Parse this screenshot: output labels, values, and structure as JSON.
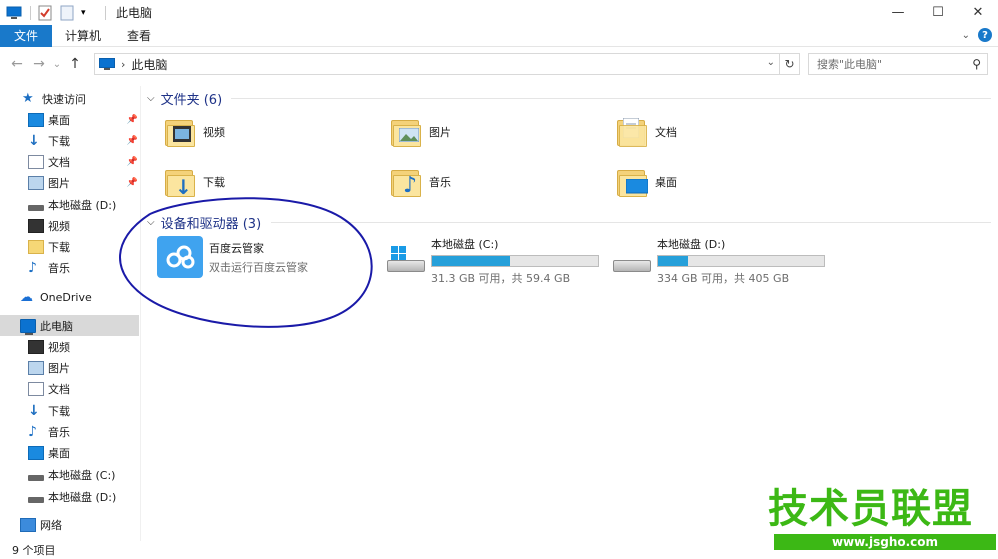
{
  "window": {
    "title": "此电脑",
    "minimize_glyph": "—",
    "maximize_glyph": "☐",
    "close_glyph": "✕"
  },
  "ribbon": {
    "tabs": [
      {
        "label": "文件"
      },
      {
        "label": "计算机"
      },
      {
        "label": "查看"
      }
    ],
    "expand_glyph": "⌄",
    "help_glyph": "?"
  },
  "address": {
    "back_glyph": "←",
    "forward_glyph": "→",
    "recent_glyph": "⌄",
    "up_glyph": "↑",
    "chevron_glyph": "›",
    "path": "此电脑",
    "dropdown_glyph": "⌄",
    "refresh_glyph": "↻"
  },
  "search": {
    "placeholder": "搜索\"此电脑\"",
    "icon_glyph": "⚲"
  },
  "sidebar": {
    "quick_access": {
      "label": "快速访问",
      "items": [
        {
          "label": "桌面",
          "pinned": true
        },
        {
          "label": "下载",
          "pinned": true
        },
        {
          "label": "文档",
          "pinned": true
        },
        {
          "label": "图片",
          "pinned": true
        },
        {
          "label": "本地磁盘 (D:)",
          "pinned": false
        },
        {
          "label": "视频",
          "pinned": false
        },
        {
          "label": "下载",
          "pinned": false
        },
        {
          "label": "音乐",
          "pinned": false
        }
      ]
    },
    "onedrive": {
      "label": "OneDrive"
    },
    "this_pc": {
      "label": "此电脑",
      "items": [
        {
          "label": "视频"
        },
        {
          "label": "图片"
        },
        {
          "label": "文档"
        },
        {
          "label": "下载"
        },
        {
          "label": "音乐"
        },
        {
          "label": "桌面"
        },
        {
          "label": "本地磁盘 (C:)"
        },
        {
          "label": "本地磁盘 (D:)"
        }
      ]
    },
    "network": {
      "label": "网络"
    }
  },
  "main": {
    "folders_group": {
      "header": "文件夹 (6)",
      "items": [
        {
          "label": "视频"
        },
        {
          "label": "图片"
        },
        {
          "label": "文档"
        },
        {
          "label": "下载"
        },
        {
          "label": "音乐"
        },
        {
          "label": "桌面"
        }
      ]
    },
    "devices_group": {
      "header": "设备和驱动器 (3)",
      "app": {
        "name": "百度云管家",
        "subtitle": "双击运行百度云管家"
      },
      "drives": [
        {
          "name": "本地磁盘 (C:)",
          "space": "31.3 GB 可用，共 59.4 GB",
          "used_fraction": 0.47
        },
        {
          "name": "本地磁盘 (D:)",
          "space": "334 GB 可用，共 405 GB",
          "used_fraction": 0.18
        }
      ]
    }
  },
  "status": {
    "text": "9 个项目"
  },
  "watermark": {
    "main": "技术员联盟",
    "url": "www.jsgho.com"
  },
  "colors": {
    "accent": "#1979ca",
    "drive_bar": "#26a0da",
    "group_header": "#1e3287",
    "watermark": "#3cb815",
    "annotation": "#1a1aa8"
  }
}
